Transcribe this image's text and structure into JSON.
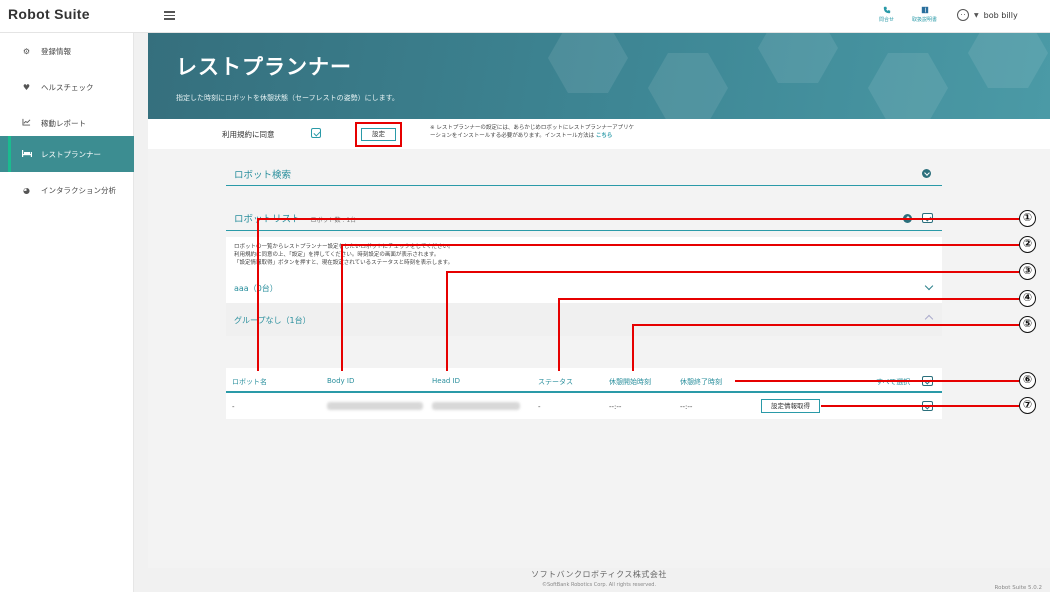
{
  "app": {
    "brand": "Robot Suite"
  },
  "topbar": {
    "contact_label": "問合せ",
    "manual_label": "取扱説明書",
    "user_name": "bob billy"
  },
  "sidebar": {
    "items": [
      {
        "label": "登録情報",
        "icon": "gears-icon"
      },
      {
        "label": "ヘルスチェック",
        "icon": "heart-pulse-icon"
      },
      {
        "label": "稼動レポート",
        "icon": "line-chart-icon"
      },
      {
        "label": "レストプランナー",
        "icon": "bed-icon",
        "active": true
      },
      {
        "label": "インタラクション分析",
        "icon": "pie-chart-icon"
      }
    ]
  },
  "hero": {
    "title": "レストプランナー",
    "subtitle": "指定した時刻にロボットを休憩状態（セーフレストの姿勢）にします。"
  },
  "agreement": {
    "label": "利用規約に同意",
    "settings_button": "設定",
    "notice_line1": "※ レストプランナーの設定には、あらかじめロボットにレストプランナーアプリケ",
    "notice_line2": "ーションをインストールする必要があります。インストール方法は",
    "notice_link": "こちら"
  },
  "robot_search": {
    "title": "ロボット検索"
  },
  "robot_list": {
    "title": "ロボットリスト",
    "count": "ロボット数 : 1台",
    "description_line1": "ロボットの一覧からレストプランナー設定をしたいロボットにチェックをしてください。",
    "description_line2": "利用規約に同意の上、「設定」を押してください。時刻設定の画面が表示されます。",
    "description_line3": "「設定情報取得」ボタンを押すと、現在設定されているステータスと時刻を表示します。"
  },
  "groups": [
    {
      "label": "aaa（0台）",
      "expanded": false
    },
    {
      "label": "グループなし（1台）",
      "expanded": true
    }
  ],
  "table": {
    "columns": [
      "ロボット名",
      "Body ID",
      "Head ID",
      "ステータス",
      "休憩開始時刻",
      "休憩終了時刻"
    ],
    "select_all": "すべて選択",
    "rows": [
      {
        "robot_name": "-",
        "status": "-",
        "rest_start": "--:--",
        "rest_end": "--:--",
        "fetch_button": "設定情報取得"
      }
    ]
  },
  "annotations": [
    "①",
    "②",
    "③",
    "④",
    "⑤",
    "⑥",
    "⑦"
  ],
  "footer": {
    "company": "ソフトバンクロボティクス株式会社",
    "copyright": "©SoftBank Robotics Corp. All rights reserved.",
    "version": "Robot Suite 5.0.2"
  },
  "colors": {
    "accent": "#2a9aa8",
    "hero": "#3e8795",
    "active": "#3c8d91",
    "annotation": "#e60000"
  }
}
